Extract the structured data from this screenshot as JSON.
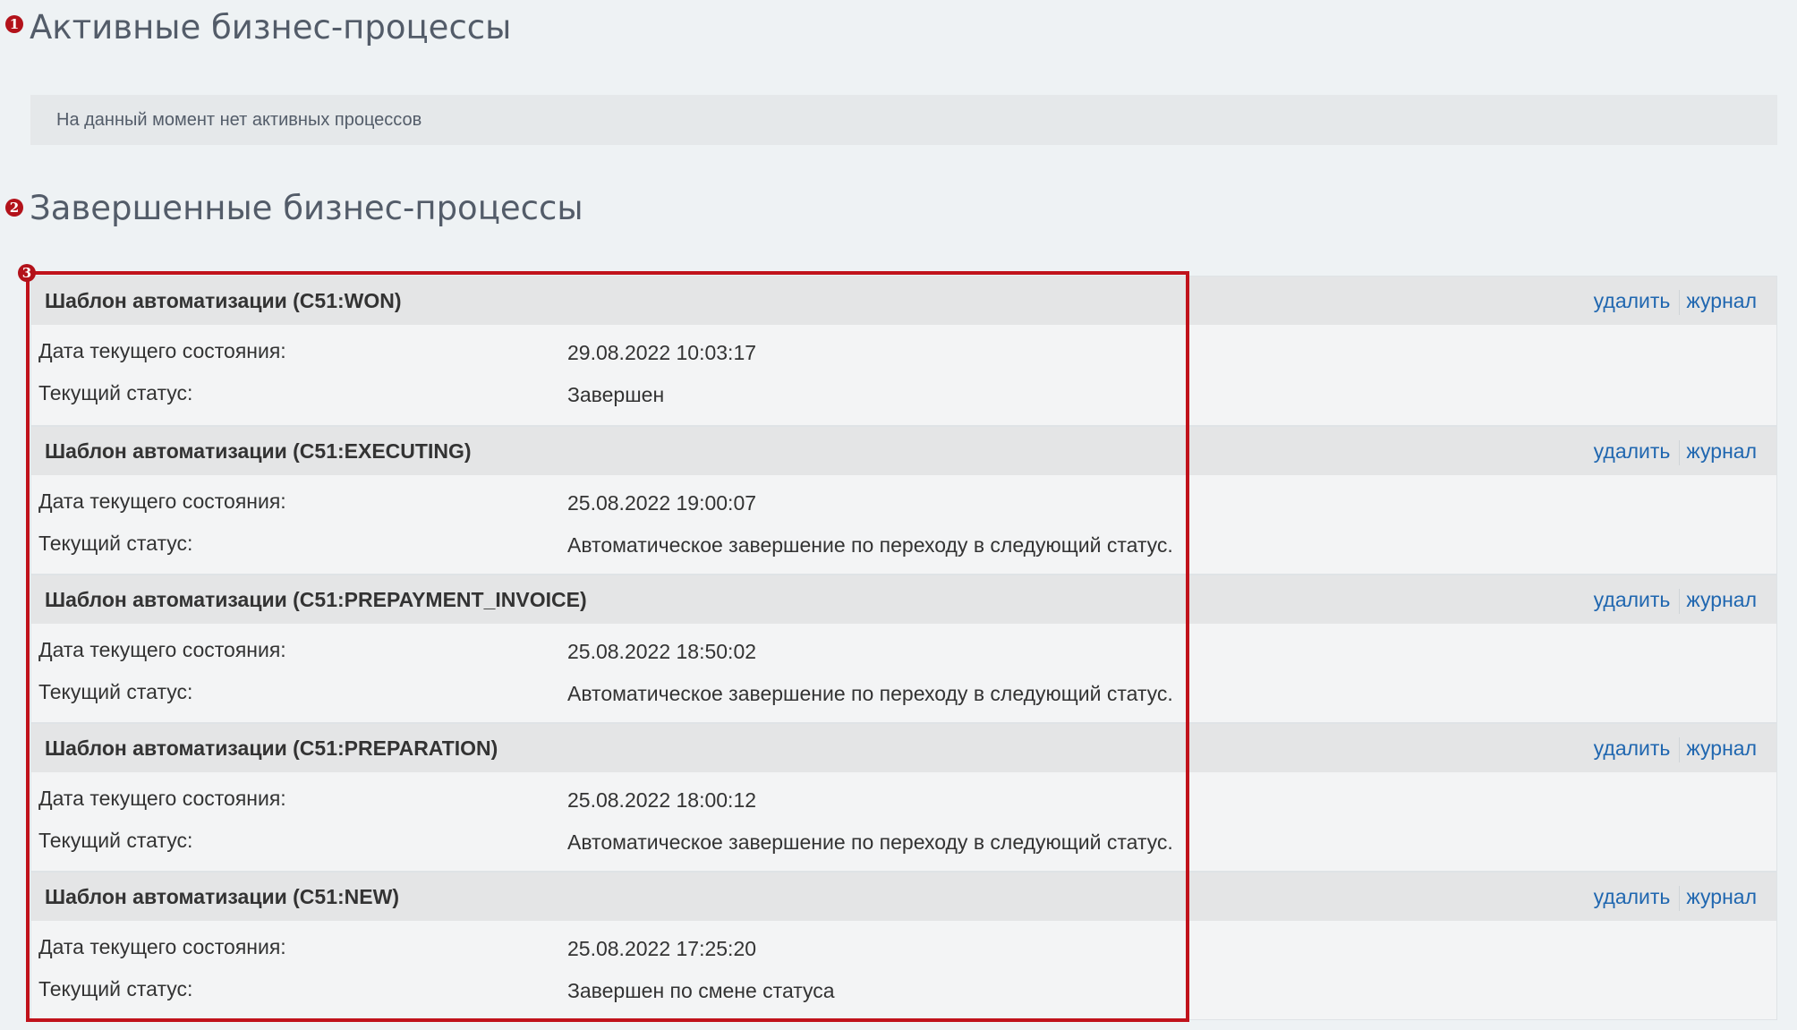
{
  "markers": [
    "1",
    "2",
    "3"
  ],
  "active_section": {
    "title": "Активные бизнес-процессы",
    "empty_text": "На данный момент нет активных процессов"
  },
  "completed_section": {
    "title": "Завершенные бизнес-процессы",
    "date_label": "Дата текущего состояния:",
    "status_label": "Текущий статус:",
    "delete_label": "удалить",
    "log_label": "журнал",
    "processes": [
      {
        "title": "Шаблон автоматизации (C51:WON)",
        "date": "29.08.2022 10:03:17",
        "status": "Завершен"
      },
      {
        "title": "Шаблон автоматизации (C51:EXECUTING)",
        "date": "25.08.2022 19:00:07",
        "status": "Автоматическое завершение по переходу в следующий статус."
      },
      {
        "title": "Шаблон автоматизации (C51:PREPAYMENT_INVOICE)",
        "date": "25.08.2022 18:50:02",
        "status": "Автоматическое завершение по переходу в следующий статус."
      },
      {
        "title": "Шаблон автоматизации (C51:PREPARATION)",
        "date": "25.08.2022 18:00:12",
        "status": "Автоматическое завершение по переходу в следующий статус."
      },
      {
        "title": "Шаблон автоматизации (C51:NEW)",
        "date": "25.08.2022 17:25:20",
        "status": "Завершен по смене статуса"
      }
    ]
  },
  "colors": {
    "link": "#2067b0",
    "marker": "#b3121a",
    "highlight": "#c0121b",
    "background": "#eef2f4"
  }
}
